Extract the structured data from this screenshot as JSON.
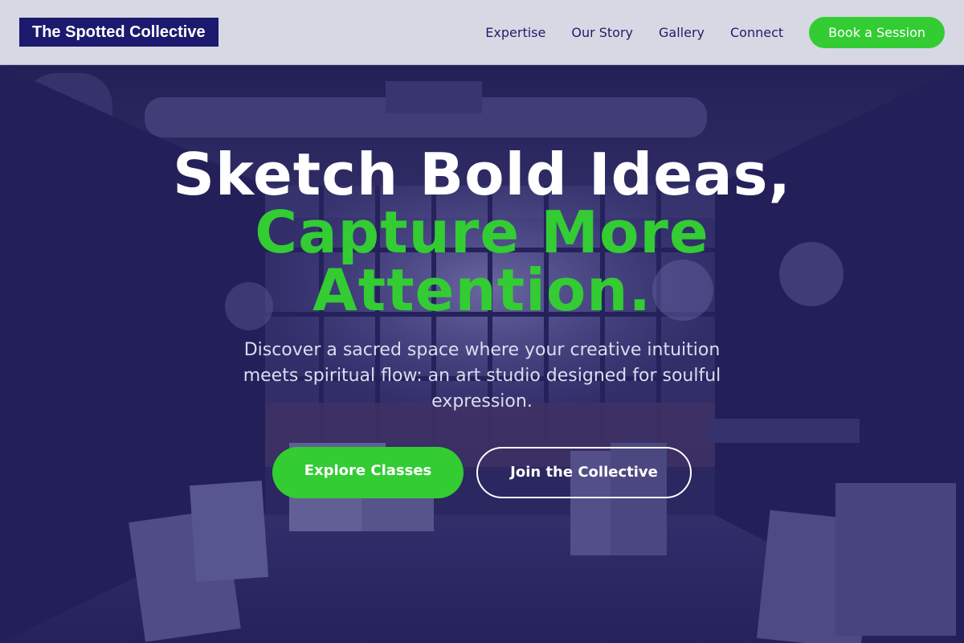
{
  "header": {
    "logo_text": "The Spotted Collective",
    "nav": [
      {
        "label": "Expertise"
      },
      {
        "label": "Our Story"
      },
      {
        "label": "Gallery"
      },
      {
        "label": "Connect"
      }
    ],
    "cta_label": "Book a Session"
  },
  "hero": {
    "title_line1": "Sketch Bold Ideas,",
    "title_line2": "Capture More",
    "title_line3": "Attention.",
    "subtitle": "Discover a sacred space where your creative intuition meets spiritual flow: an art studio designed for soulful expression.",
    "primary_button": "Explore Classes",
    "secondary_button": "Join the Collective"
  },
  "colors": {
    "brand_navy": "#1b1a6e",
    "accent_green": "#33cc33",
    "header_bg": "#d8d8e4",
    "overlay": "#1e1a6e"
  }
}
